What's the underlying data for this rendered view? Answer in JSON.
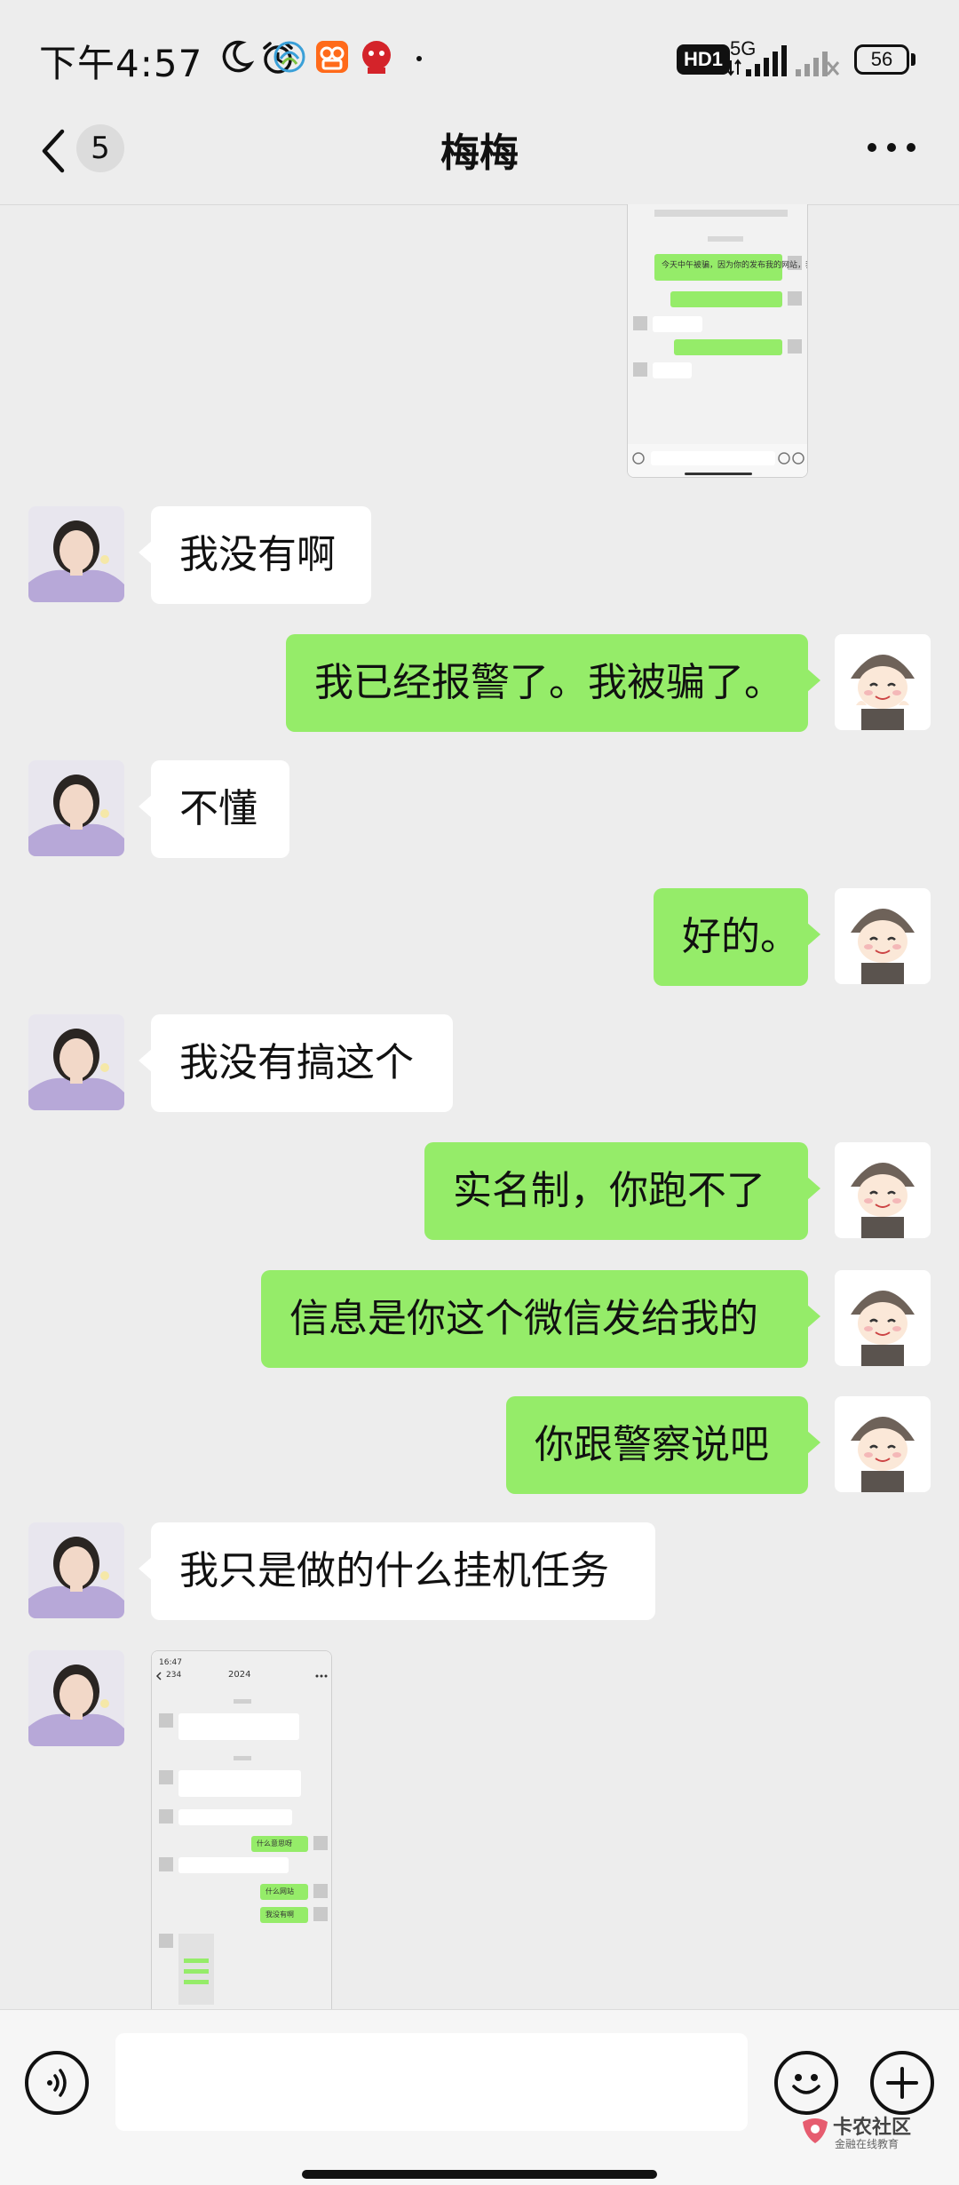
{
  "status_bar": {
    "time": "下午4:57",
    "hd_label": "HD1",
    "network": "5G",
    "battery": "56"
  },
  "header": {
    "unread_count": "5",
    "title": "梅梅"
  },
  "messages": [
    {
      "side": "in",
      "text": "我没有啊"
    },
    {
      "side": "out",
      "text": "我已经报警了。我被骗了。"
    },
    {
      "side": "in",
      "text": "不懂"
    },
    {
      "side": "out",
      "text": "好的。"
    },
    {
      "side": "in",
      "text": "我没有搞这个"
    },
    {
      "side": "out",
      "text": "实名制，你跑不了"
    },
    {
      "side": "out",
      "text": "信息是你这个微信发给我的"
    },
    {
      "side": "out",
      "text": "你跟警察说吧"
    },
    {
      "side": "in",
      "text": "我只是做的什么挂机任务"
    }
  ],
  "screenshot_top": {
    "lines": [
      "今天中午被骗，因为你的发布我的网站，我被骗了",
      "我打了110已经报警，等着了",
      "什么意思呀",
      "你发布的网站，是赌博平台",
      "什么网站"
    ]
  },
  "screenshot_bottom": {
    "time": "16:47",
    "back_count": "234",
    "title": "2024",
    "lines": [
      "我通过了你的朋友验证请求，现在我们可以开始聊天了",
      "你是犯骗子吧，因为你提供给我的网站，我已经被骗了。",
      "我在打110已经报警，着来了",
      "什么意思呀",
      "你发布的网站，是赌博平台。",
      "什么网站",
      "我没有啊"
    ]
  },
  "input_bar": {
    "placeholder": ""
  },
  "watermark": {
    "name": "卡农社区",
    "sub": "金融在线教育"
  },
  "colors": {
    "background": "#ededed",
    "incoming_bubble": "#ffffff",
    "outgoing_bubble": "#95ec69",
    "text": "#111111"
  }
}
